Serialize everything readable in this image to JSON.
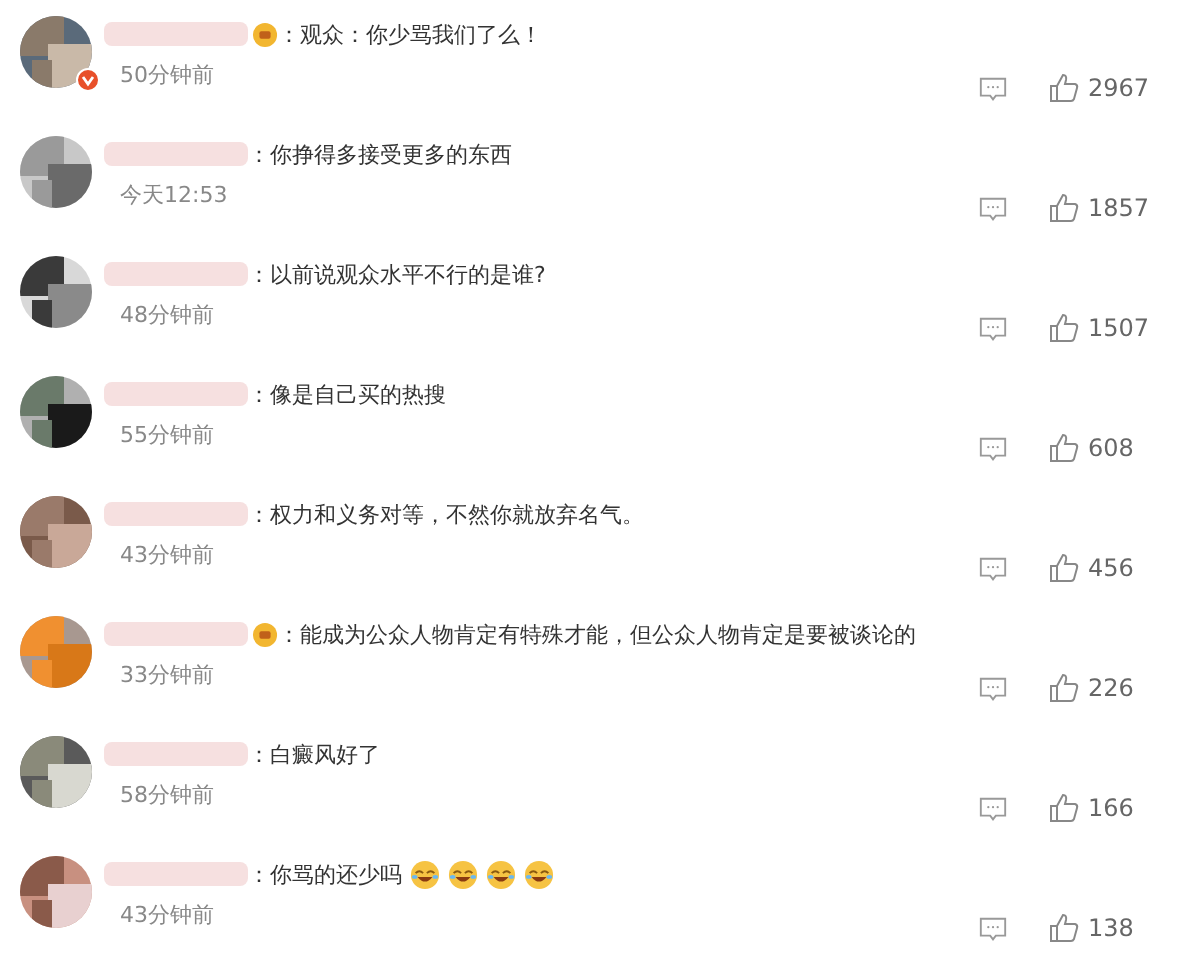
{
  "comments": [
    {
      "text": "：观众：你少骂我们了么！",
      "time": "50分钟前",
      "likes": "2967",
      "badge": true,
      "verified": true
    },
    {
      "text": "：你挣得多接受更多的东西",
      "time": "今天12:53",
      "likes": "1857",
      "badge": false,
      "verified": false
    },
    {
      "text": "：以前说观众水平不行的是谁?",
      "time": "48分钟前",
      "likes": "1507",
      "badge": false,
      "verified": false
    },
    {
      "text": "：像是自己买的热搜",
      "time": "55分钟前",
      "likes": "608",
      "badge": false,
      "verified": false
    },
    {
      "text": "：权力和义务对等，不然你就放弃名气。",
      "time": "43分钟前",
      "likes": "456",
      "badge": false,
      "verified": false
    },
    {
      "text": "：能成为公众人物肯定有特殊才能，但公众人物肯定是要被谈论的",
      "time": "33分钟前",
      "likes": "226",
      "badge": true,
      "verified": false
    },
    {
      "text": "：白癜风好了",
      "time": "58分钟前",
      "likes": "166",
      "badge": false,
      "verified": false
    },
    {
      "text": "：你骂的还少吗",
      "time": "43分钟前",
      "likes": "138",
      "badge": false,
      "verified": false,
      "emojis": [
        {
          "kind": "laugh"
        },
        {
          "kind": "laugh"
        },
        {
          "kind": "laugh"
        },
        {
          "kind": "laugh"
        }
      ]
    }
  ]
}
